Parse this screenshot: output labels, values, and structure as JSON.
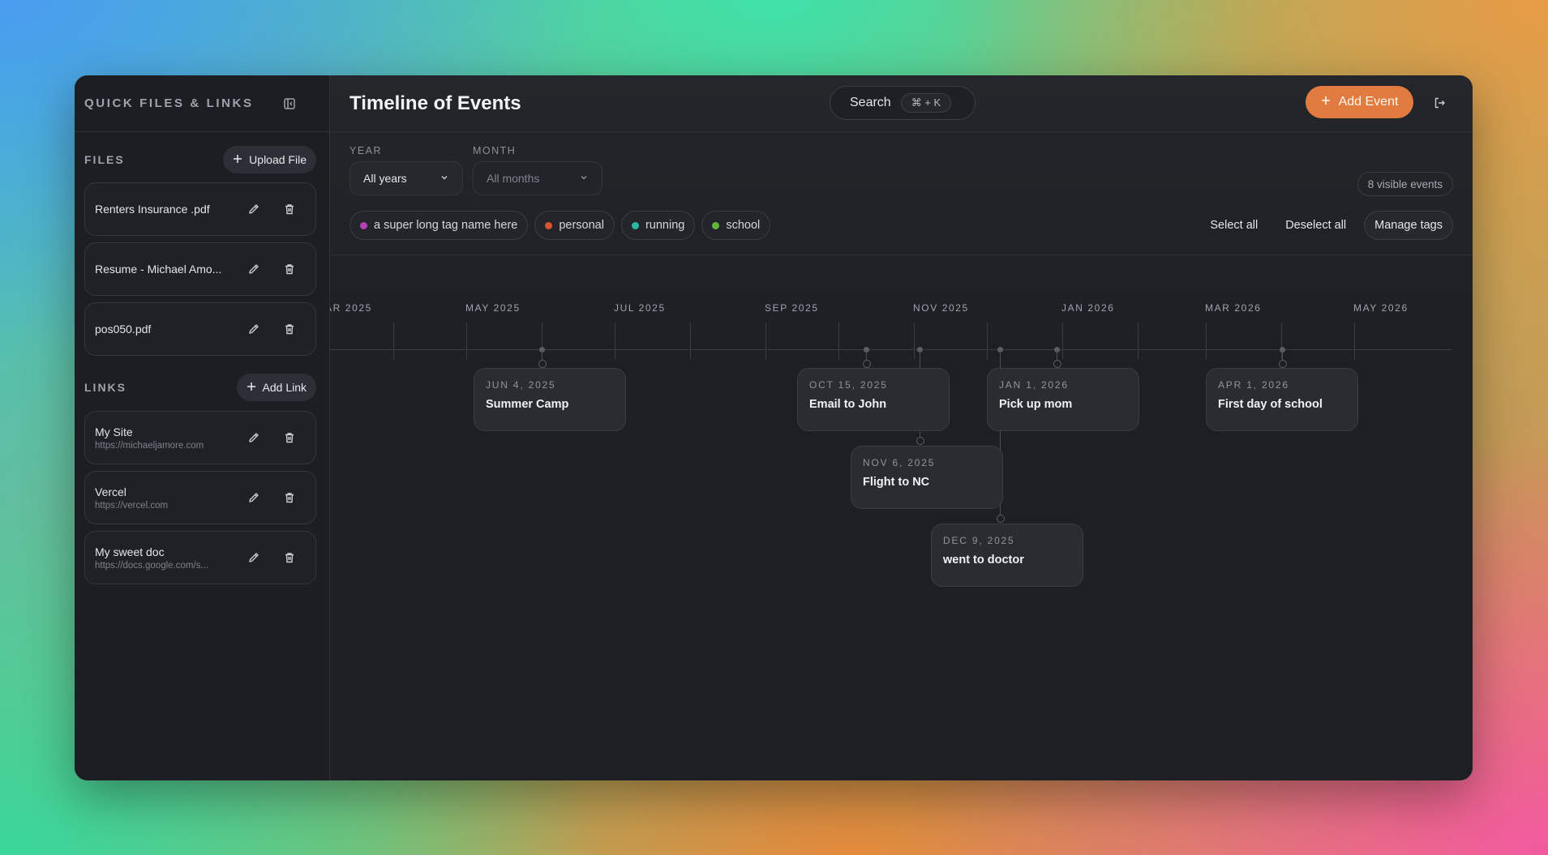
{
  "sidebar": {
    "title": "QUICK FILES & LINKS",
    "files_section": {
      "title": "FILES",
      "upload_label": "Upload File"
    },
    "files": [
      {
        "name": "Renters Insurance .pdf"
      },
      {
        "name": "Resume - Michael Amo..."
      },
      {
        "name": "pos050.pdf"
      }
    ],
    "links_section": {
      "title": "LINKS",
      "add_label": "Add Link"
    },
    "links": [
      {
        "name": "My Site",
        "url": "https://michaeljamore.com"
      },
      {
        "name": "Vercel",
        "url": "https://vercel.com"
      },
      {
        "name": "My sweet doc",
        "url": "https://docs.google.com/s..."
      }
    ]
  },
  "header": {
    "title": "Timeline of Events",
    "search_label": "Search",
    "search_shortcut": "⌘ + K",
    "add_event_label": "Add Event"
  },
  "filters": {
    "year_label": "YEAR",
    "year_value": "All years",
    "month_label": "MONTH",
    "month_value": "All months",
    "visible_count": "8 visible events",
    "tags": [
      {
        "name": "a super long tag name here",
        "color": "#b441b6"
      },
      {
        "name": "personal",
        "color": "#d9542c"
      },
      {
        "name": "running",
        "color": "#2bb7a6"
      },
      {
        "name": "school",
        "color": "#5fb43a"
      }
    ],
    "select_all": "Select all",
    "deselect_all": "Deselect all",
    "manage_tags": "Manage tags"
  },
  "timeline": {
    "months": [
      "AR 2025",
      "MAY 2025",
      "JUL 2025",
      "SEP 2025",
      "NOV 2025",
      "JAN 2026",
      "MAR 2026",
      "MAY 2026"
    ],
    "events": [
      {
        "date": "JUN 4, 2025",
        "title": "Summer Camp"
      },
      {
        "date": "OCT 15, 2025",
        "title": "Email to John"
      },
      {
        "date": "NOV 6, 2025",
        "title": "Flight to NC"
      },
      {
        "date": "DEC 9, 2025",
        "title": "went to doctor"
      },
      {
        "date": "JAN 1, 2026",
        "title": "Pick up mom"
      },
      {
        "date": "APR 1, 2026",
        "title": "First day of school"
      }
    ]
  },
  "colors": {
    "accent": "#e17b40",
    "bg": "#1d1f24"
  }
}
